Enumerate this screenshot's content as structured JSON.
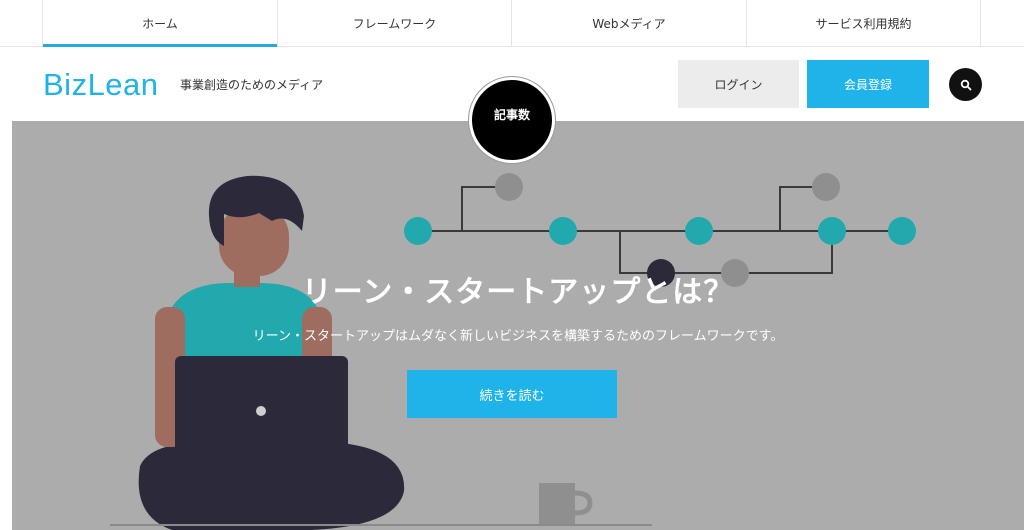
{
  "topnav": {
    "tabs": [
      {
        "label": "ホーム"
      },
      {
        "label": "フレームワーク"
      },
      {
        "label": "Webメディア"
      },
      {
        "label": "サービス利用規約"
      }
    ]
  },
  "header": {
    "logo": "BizLean",
    "tagline": "事業創造のためのメディア",
    "login_label": "ログイン",
    "register_label": "会員登録",
    "search_icon": "search-icon"
  },
  "badge": {
    "label": "記事数"
  },
  "hero": {
    "title": "リーン・スタートアップとは？",
    "subtitle": "リーン・スタートアップはムダなく新しいビジネスを構築するためのフレームワークです。",
    "cta_label": "続きを読む"
  },
  "colors": {
    "accent": "#1fb3ea",
    "hero_bg": "#acacac",
    "node_teal": "#21a9ad",
    "node_gray": "#8f8f8f"
  }
}
